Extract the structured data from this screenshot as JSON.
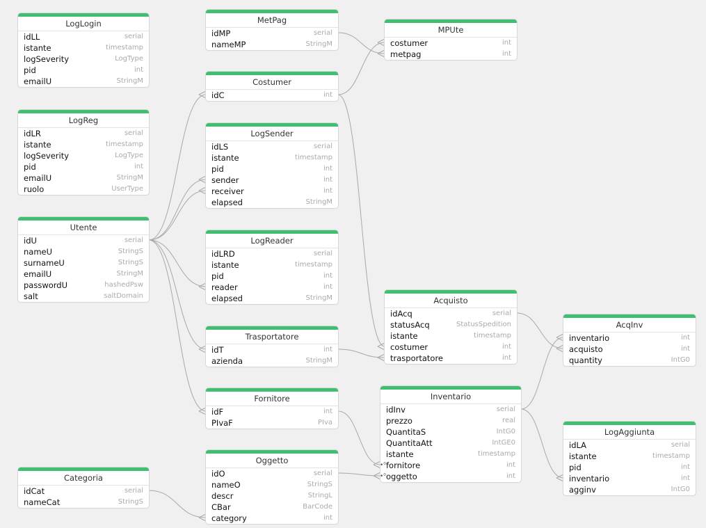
{
  "tables": [
    {
      "id": "LogLogin",
      "columns": [
        {
          "name": "idLL",
          "type": "serial"
        },
        {
          "name": "istante",
          "type": "timestamp"
        },
        {
          "name": "logSeverity",
          "type": "LogType"
        },
        {
          "name": "pid",
          "type": "int"
        },
        {
          "name": "emailU",
          "type": "StringM"
        }
      ]
    },
    {
      "id": "LogReg",
      "columns": [
        {
          "name": "idLR",
          "type": "serial"
        },
        {
          "name": "istante",
          "type": "timestamp"
        },
        {
          "name": "logSeverity",
          "type": "LogType"
        },
        {
          "name": "pid",
          "type": "int"
        },
        {
          "name": "emailU",
          "type": "StringM"
        },
        {
          "name": "ruolo",
          "type": "UserType"
        }
      ]
    },
    {
      "id": "Utente",
      "columns": [
        {
          "name": "idU",
          "type": "serial"
        },
        {
          "name": "nameU",
          "type": "StringS"
        },
        {
          "name": "surnameU",
          "type": "StringS"
        },
        {
          "name": "emailU",
          "type": "StringM"
        },
        {
          "name": "passwordU",
          "type": "hashedPsw"
        },
        {
          "name": "salt",
          "type": "saltDomain"
        }
      ]
    },
    {
      "id": "Categoria",
      "columns": [
        {
          "name": "idCat",
          "type": "serial"
        },
        {
          "name": "nameCat",
          "type": "StringS"
        }
      ]
    },
    {
      "id": "MetPag",
      "columns": [
        {
          "name": "idMP",
          "type": "serial"
        },
        {
          "name": "nameMP",
          "type": "StringM"
        }
      ]
    },
    {
      "id": "Costumer",
      "columns": [
        {
          "name": "idC",
          "type": "int"
        }
      ]
    },
    {
      "id": "LogSender",
      "columns": [
        {
          "name": "idLS",
          "type": "serial"
        },
        {
          "name": "istante",
          "type": "timestamp"
        },
        {
          "name": "pid",
          "type": "int"
        },
        {
          "name": "sender",
          "type": "int"
        },
        {
          "name": "receiver",
          "type": "int"
        },
        {
          "name": "elapsed",
          "type": "StringM"
        }
      ]
    },
    {
      "id": "LogReader",
      "columns": [
        {
          "name": "idLRD",
          "type": "serial"
        },
        {
          "name": "istante",
          "type": "timestamp"
        },
        {
          "name": "pid",
          "type": "int"
        },
        {
          "name": "reader",
          "type": "int"
        },
        {
          "name": "elapsed",
          "type": "StringM"
        }
      ]
    },
    {
      "id": "Trasportatore",
      "columns": [
        {
          "name": "idT",
          "type": "int"
        },
        {
          "name": "azienda",
          "type": "StringM"
        }
      ]
    },
    {
      "id": "Fornitore",
      "columns": [
        {
          "name": "idF",
          "type": "int"
        },
        {
          "name": "PIvaF",
          "type": "PIva"
        }
      ]
    },
    {
      "id": "Oggetto",
      "columns": [
        {
          "name": "idO",
          "type": "serial"
        },
        {
          "name": "nameO",
          "type": "StringS"
        },
        {
          "name": "descr",
          "type": "StringL"
        },
        {
          "name": "CBar",
          "type": "BarCode"
        },
        {
          "name": "category",
          "type": "int"
        }
      ]
    },
    {
      "id": "MPUte",
      "columns": [
        {
          "name": "costumer",
          "type": "int"
        },
        {
          "name": "metpag",
          "type": "int"
        }
      ]
    },
    {
      "id": "Acquisto",
      "columns": [
        {
          "name": "idAcq",
          "type": "serial"
        },
        {
          "name": "statusAcq",
          "type": "StatusSpedition"
        },
        {
          "name": "istante",
          "type": "timestamp"
        },
        {
          "name": "costumer",
          "type": "int"
        },
        {
          "name": "trasportatore",
          "type": "int"
        }
      ]
    },
    {
      "id": "Inventario",
      "columns": [
        {
          "name": "idInv",
          "type": "serial"
        },
        {
          "name": "prezzo",
          "type": "real"
        },
        {
          "name": "QuantitaS",
          "type": "IntG0"
        },
        {
          "name": "QuantitaAtt",
          "type": "IntGE0"
        },
        {
          "name": "istante",
          "type": "timestamp"
        },
        {
          "name": "fornitore",
          "type": "int",
          "fk": true
        },
        {
          "name": "oggetto",
          "type": "int",
          "fk": true
        }
      ]
    },
    {
      "id": "AcqInv",
      "columns": [
        {
          "name": "inventario",
          "type": "int"
        },
        {
          "name": "acquisto",
          "type": "int"
        },
        {
          "name": "quantity",
          "type": "IntG0"
        }
      ]
    },
    {
      "id": "LogAggiunta",
      "columns": [
        {
          "name": "idLA",
          "type": "serial"
        },
        {
          "name": "istante",
          "type": "timestamp"
        },
        {
          "name": "pid",
          "type": "int"
        },
        {
          "name": "inventario",
          "type": "int"
        },
        {
          "name": "agginv",
          "type": "IntG0"
        }
      ]
    }
  ],
  "relations": [
    {
      "from": "Utente.0",
      "to": "Costumer.0"
    },
    {
      "from": "Utente.0",
      "to": "LogSender.3"
    },
    {
      "from": "Utente.0",
      "to": "LogSender.4"
    },
    {
      "from": "Utente.0",
      "to": "LogReader.3"
    },
    {
      "from": "Utente.0",
      "to": "Trasportatore.0"
    },
    {
      "from": "Utente.0",
      "to": "Fornitore.0"
    },
    {
      "from": "MetPag.0",
      "to": "MPUte.1"
    },
    {
      "from": "Costumer.0",
      "to": "MPUte.0"
    },
    {
      "from": "Costumer.0",
      "to": "Acquisto.3"
    },
    {
      "from": "Trasportatore.0",
      "to": "Acquisto.4"
    },
    {
      "from": "Fornitore.0",
      "to": "Inventario.5"
    },
    {
      "from": "Oggetto.0",
      "to": "Inventario.6"
    },
    {
      "from": "Categoria.0",
      "to": "Oggetto.4"
    },
    {
      "from": "Acquisto.0",
      "to": "AcqInv.1"
    },
    {
      "from": "Inventario.0",
      "to": "AcqInv.0"
    },
    {
      "from": "Inventario.0",
      "to": "LogAggiunta.3"
    }
  ]
}
